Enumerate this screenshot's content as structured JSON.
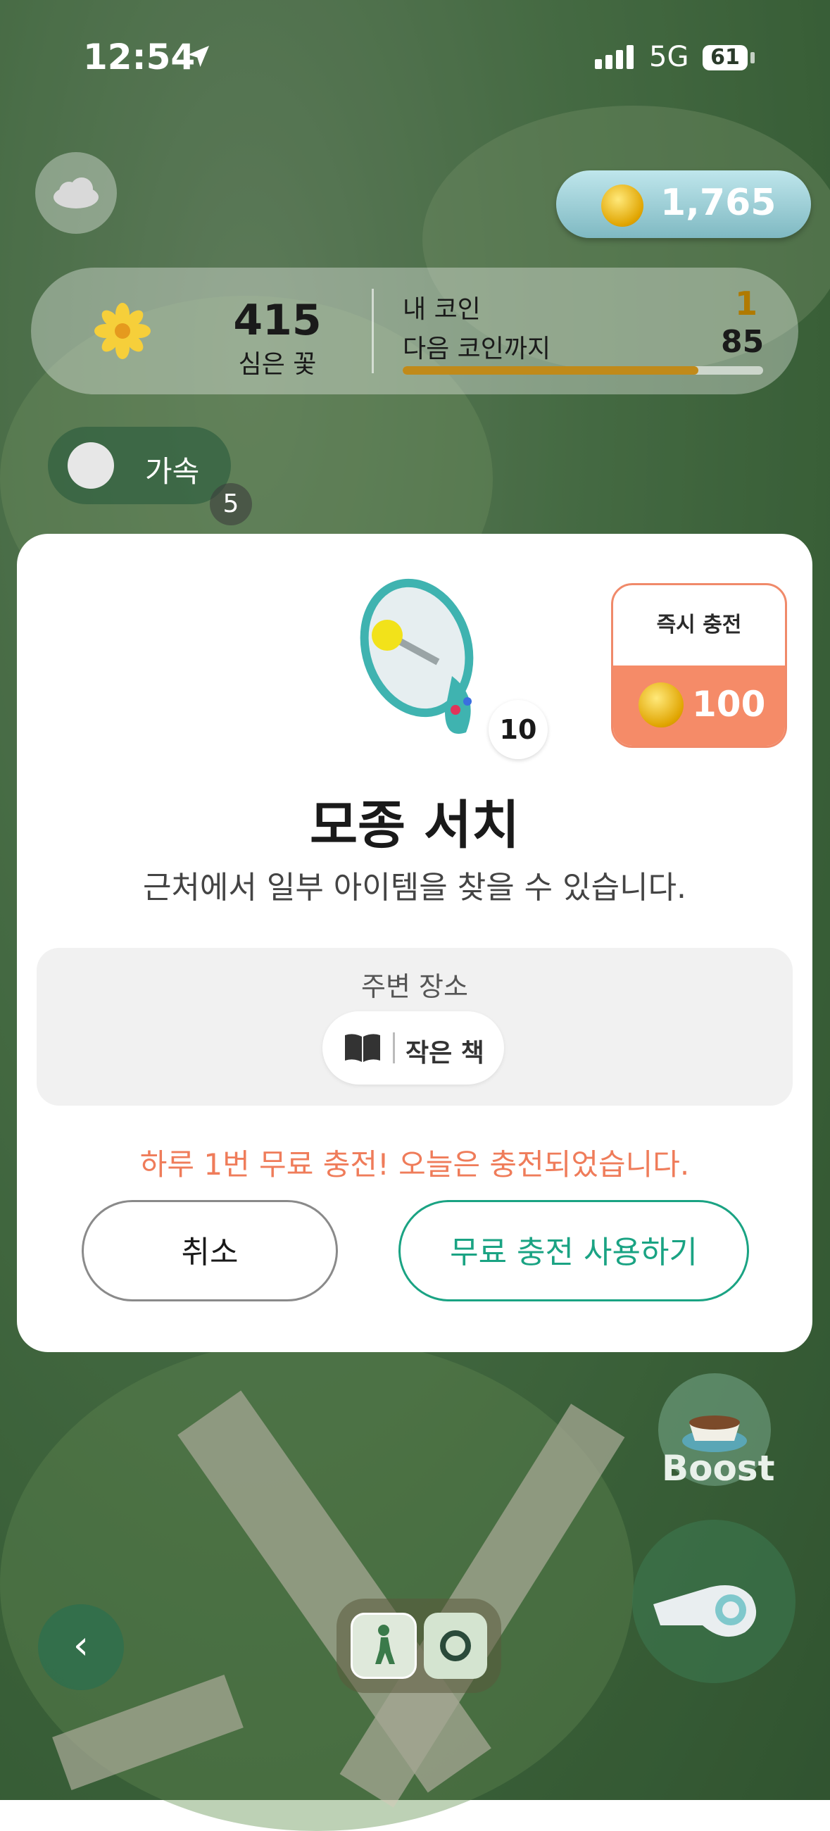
{
  "status_bar": {
    "time": "12:54",
    "network": "5G",
    "battery": "61"
  },
  "hud": {
    "coin_balance": "1,765",
    "stats": {
      "planted_count": "415",
      "planted_label": "심은 꽃",
      "my_coin_label": "내 코인",
      "my_coin_value": "1",
      "next_coin_label": "다음 코인까지",
      "next_coin_value": "85",
      "next_coin_progress": 0.82
    },
    "speed": {
      "label": "가속",
      "count": "5"
    }
  },
  "modal": {
    "item_count": "10",
    "instant_charge": {
      "label": "즉시 충전",
      "price": "100"
    },
    "title": "모종 서치",
    "description": "근처에서 일부 아이템을 찾을 수 있습니다.",
    "nearby": {
      "title": "주변 장소",
      "place": "작은 책"
    },
    "notice": "하루 1번 무료 충전! 오늘은 충전되었습니다.",
    "cancel_label": "취소",
    "free_charge_label": "무료 충전 사용하기"
  },
  "bottom": {
    "boost_label": "Boost",
    "back_label": "‹"
  },
  "colors": {
    "accent_green": "#1aa383",
    "notice_orange": "#ef7c5a",
    "instant_orange": "#f58b68",
    "coin_gold": "#e0a400"
  }
}
